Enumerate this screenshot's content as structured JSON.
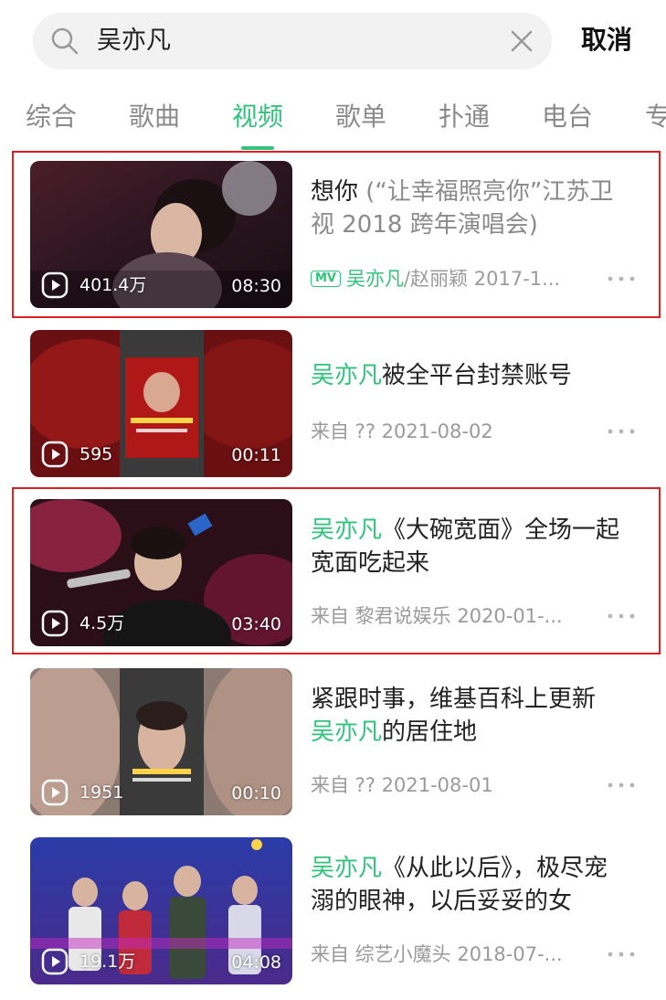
{
  "search": {
    "query": "吴亦凡",
    "cancel_label": "取消"
  },
  "tabs": [
    {
      "label": "综合",
      "active": false
    },
    {
      "label": "歌曲",
      "active": false
    },
    {
      "label": "视频",
      "active": true
    },
    {
      "label": "歌单",
      "active": false
    },
    {
      "label": "扑通",
      "active": false
    },
    {
      "label": "电台",
      "active": false
    },
    {
      "label": "专",
      "active": false
    }
  ],
  "colors": {
    "accent": "#31c27c",
    "highlight_box": "#e02020",
    "meta_text": "#9a9a9a"
  },
  "videos": [
    {
      "title_hl": "",
      "title_rest": "想你",
      "title_sub": " (“让幸福照亮你”江苏卫视 2018 跨年演唱会)",
      "badge": "MV",
      "meta_hl": "吴亦凡",
      "meta_rest": "/赵丽颖 2017-1...",
      "plays": "401.4万",
      "duration": "08:30",
      "highlighted": true
    },
    {
      "title_hl": "吴亦凡",
      "title_rest": "被全平台封禁账号",
      "title_sub": "",
      "badge": "",
      "meta_hl": "",
      "meta_rest": "来自 ?? 2021-08-02",
      "plays": "595",
      "duration": "00:11",
      "highlighted": false
    },
    {
      "title_hl": "吴亦凡",
      "title_rest": "《大碗宽面》全场一起宽面吃起来",
      "title_sub": "",
      "badge": "",
      "meta_hl": "",
      "meta_rest": "来自 黎君说娱乐 2020-01-...",
      "plays": "4.5万",
      "duration": "03:40",
      "highlighted": true
    },
    {
      "title_hl": "",
      "title_rest": "紧跟时事，维基百科上更新",
      "title_hl2": "吴亦凡",
      "title_rest2": "的居住地",
      "badge": "",
      "meta_hl": "",
      "meta_rest": "来自 ?? 2021-08-01",
      "plays": "1951",
      "duration": "00:10",
      "highlighted": false
    },
    {
      "title_hl": "吴亦凡",
      "title_rest": "《从此以后》，极尽宠溺的眼神，以后妥妥的女",
      "title_sub": "",
      "badge": "",
      "meta_hl": "",
      "meta_rest": "来自 综艺小魔头 2018-07-...",
      "plays": "19.1万",
      "duration": "04:08",
      "highlighted": false
    }
  ]
}
